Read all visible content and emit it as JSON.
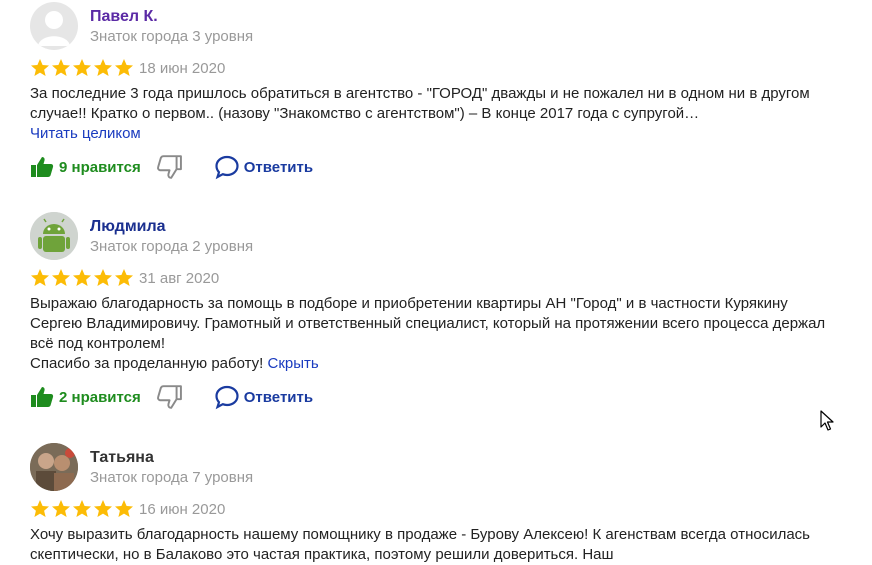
{
  "colors": {
    "star": "#fcbc06",
    "like": "#1e8c1e",
    "link": "#1a3bbf",
    "author_pavel": "#5b2aa5",
    "author_ludmila": "#1a2f8f"
  },
  "reviews": [
    {
      "author": "Павел К.",
      "level": "Знаток города 3 уровня",
      "rating": 5,
      "date": "18 июн 2020",
      "text": "За последние 3 года пришлось обратиться в агентство - \"ГОРОД\" дважды и не пожалел ни в одном ни в другом случае!! Кратко о первом.. (назову \"Знакомство с агентством\") – В конце 2017 года с супругой…",
      "read_more": "Читать целиком",
      "likes": "9 нравится",
      "reply": "Ответить",
      "avatar_icon": "default-user-icon"
    },
    {
      "author": "Людмила",
      "level": "Знаток города 2 уровня",
      "rating": 5,
      "date": "31 авг 2020",
      "text": "Выражаю благодарность за помощь в подборе и приобретении квартиры АН \"Город\" и в частности Курякину Сергею Владимировичу. Грамотный и ответственный специалист, который на протяжении всего процесса держал всё под контролем!",
      "text2": "Спасибо за проделанную работу!",
      "hide": "Скрыть",
      "likes": "2 нравится",
      "reply": "Ответить",
      "avatar_icon": "android-icon"
    },
    {
      "author": "Татьяна",
      "level": "Знаток города 7 уровня",
      "rating": 5,
      "date": "16 июн 2020",
      "text": "Хочу выразить благодарность нашему помощнику в продаже - Бурову Алексею! К агенствам всегда относилась скептически, но в Балаково это частая практика, поэтому решили довериться. Наш",
      "avatar_icon": "photo-avatar"
    }
  ]
}
